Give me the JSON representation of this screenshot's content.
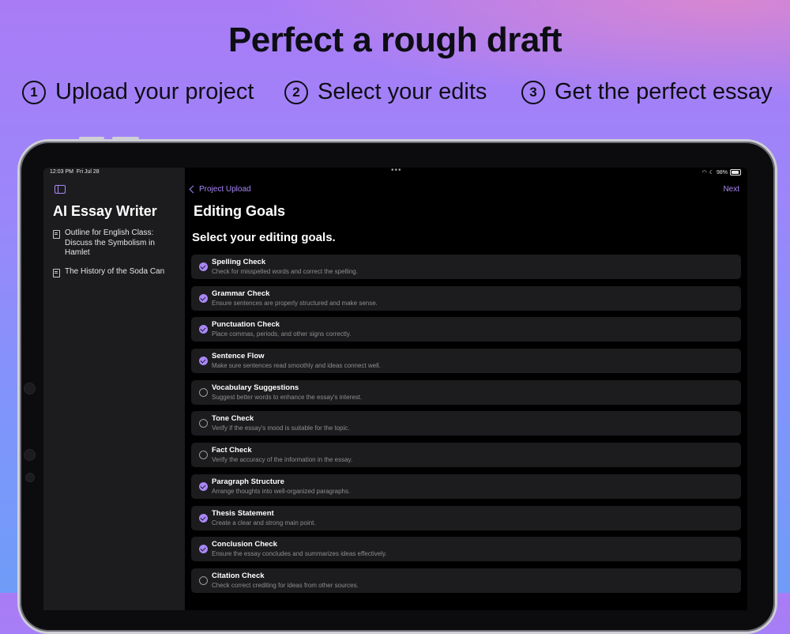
{
  "headline": "Perfect a rough draft",
  "steps": [
    {
      "num": "1",
      "label": "Upload your project"
    },
    {
      "num": "2",
      "label": "Select your edits"
    },
    {
      "num": "3",
      "label": "Get the perfect essay"
    }
  ],
  "status_bar": {
    "time": "12:03 PM",
    "date": "Fri Jul 28",
    "dots": "•••",
    "battery": "98%"
  },
  "sidebar": {
    "title": "AI Essay Writer",
    "documents": [
      "Outline for English Class: Discuss the Symbolism in Hamlet",
      "The History of the Soda Can"
    ]
  },
  "nav": {
    "back_label": "Project Upload",
    "next_label": "Next"
  },
  "main": {
    "title": "Editing Goals",
    "subtitle": "Select your editing goals.",
    "goals": [
      {
        "title": "Spelling Check",
        "desc": "Check for misspelled words and correct the spelling.",
        "checked": true
      },
      {
        "title": "Grammar Check",
        "desc": "Ensure sentences are properly structured and make sense.",
        "checked": true
      },
      {
        "title": "Punctuation Check",
        "desc": "Place commas, periods, and other signs correctly.",
        "checked": true
      },
      {
        "title": "Sentence Flow",
        "desc": "Make sure sentences read smoothly and ideas connect well.",
        "checked": true
      },
      {
        "title": "Vocabulary Suggestions",
        "desc": "Suggest better words to enhance the essay's interest.",
        "checked": false
      },
      {
        "title": "Tone Check",
        "desc": "Verify if the essay's mood is suitable for the topic.",
        "checked": false
      },
      {
        "title": "Fact Check",
        "desc": "Verify the accuracy of the information in the essay.",
        "checked": false
      },
      {
        "title": "Paragraph Structure",
        "desc": "Arrange thoughts into well-organized paragraphs.",
        "checked": true
      },
      {
        "title": "Thesis Statement",
        "desc": "Create a clear and strong main point.",
        "checked": true
      },
      {
        "title": "Conclusion Check",
        "desc": "Ensure the essay concludes and summarizes ideas effectively.",
        "checked": true
      },
      {
        "title": "Citation Check",
        "desc": "Check correct crediting for ideas from other sources.",
        "checked": false
      }
    ]
  },
  "colors": {
    "accent": "#a987f7",
    "row_bg": "#1c1c1e",
    "sidebar_bg": "#1c1c1e"
  }
}
